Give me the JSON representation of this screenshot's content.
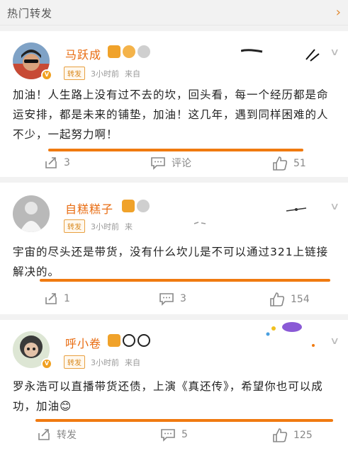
{
  "header": {
    "title": "热门转发",
    "chevron": "›"
  },
  "posts": [
    {
      "user": "马跃成",
      "tag": "转发",
      "time": "3小时前",
      "source": "来自",
      "text": "加油！人生路上没有过不去的坎，回头看，每一个经历都是命运安排，都是未来的铺垫，加油！这几年，遇到同样困难的人不少，一起努力啊！",
      "actions": {
        "repost": "3",
        "comment": "评论",
        "like": "51"
      }
    },
    {
      "user": "自糕糕子",
      "tag": "转发",
      "time": "3小时前",
      "source": "来",
      "text": "宇宙的尽头还是带货，没有什么坎儿是不可以通过321上链接解决的。",
      "actions": {
        "repost": "1",
        "comment": "3",
        "like": "154"
      }
    },
    {
      "user": "呼小卷",
      "tag": "转发",
      "time": "3小时前",
      "source": "来自",
      "text": "罗永浩可以直播带货还债，上演《真还传》，希望你也可以成功，加油😊",
      "actions": {
        "repost": "转发",
        "comment": "5",
        "like": "125"
      }
    }
  ],
  "colors": {
    "accent": "#e86b10",
    "underline": "#f07a10",
    "tag_border": "#e8a040"
  },
  "icons": [
    "share-icon",
    "comment-icon",
    "like-icon",
    "chevron-down-icon",
    "verified-badge-icon"
  ]
}
